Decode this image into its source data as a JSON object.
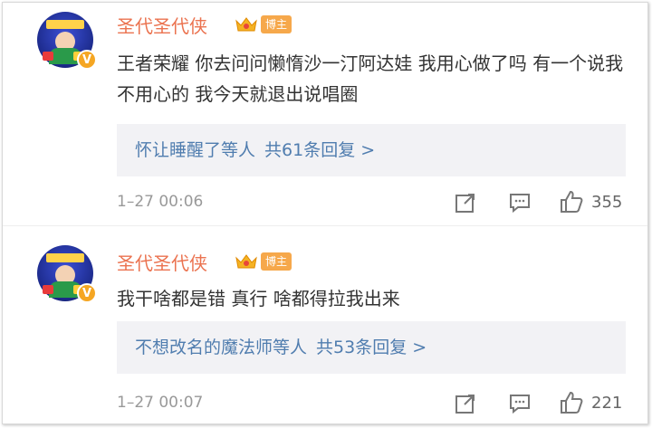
{
  "comments": [
    {
      "username": "圣代圣代侠",
      "badge": "博主",
      "verified_mark": "V",
      "text": "王者荣耀 你去问问懒惰沙一汀阿达娃 我用心做了吗 有一个说我不用心的 我今天就退出说唱圈",
      "replies": {
        "who": "怀让睡醒了等人",
        "count": "共61条回复 >"
      },
      "time": "1–27 00:06",
      "likes": "355"
    },
    {
      "username": "圣代圣代侠",
      "badge": "博主",
      "verified_mark": "V",
      "text": "我干啥都是错 真行 啥都得拉我出来",
      "replies": {
        "who": "不想改名的魔法师等人",
        "count": "共53条回复 >"
      },
      "time": "1–27 00:07",
      "likes": "221"
    }
  ],
  "icons": {
    "share": "share-icon",
    "comment": "comment-icon",
    "like": "thumbs-up-icon",
    "crown": "crown-badge-icon"
  },
  "colors": {
    "username": "#eb7350",
    "link": "#507daf",
    "badge": "#f6a84b",
    "reply_bg": "#f2f2f5"
  }
}
